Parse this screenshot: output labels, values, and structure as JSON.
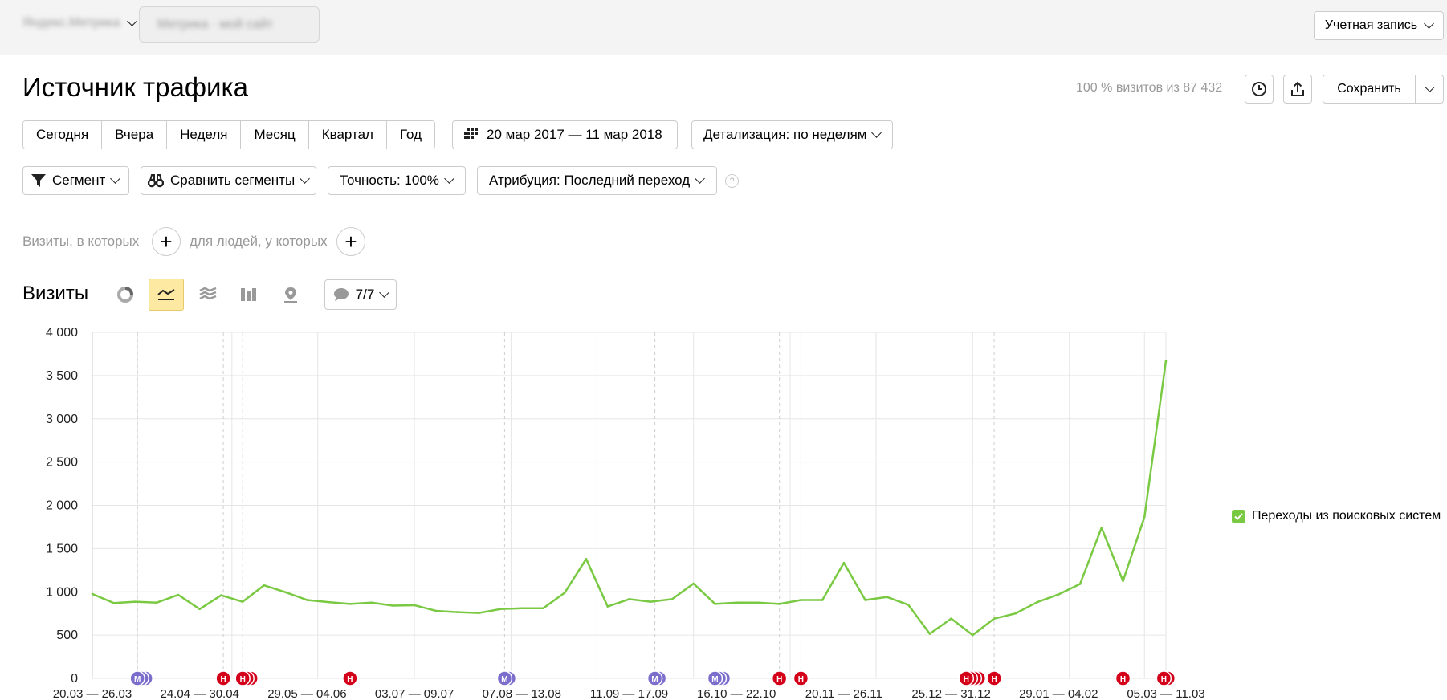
{
  "topbar": {
    "counter_name": "Яндекс.Метрика",
    "blurred_field": "Метрика · мой сайт",
    "account_label": "Учетная запись"
  },
  "header": {
    "title": "Источник трафика",
    "visits_info": "100 % визитов из 87 432",
    "save_label": "Сохранить",
    "icons": [
      "clock-icon",
      "export-icon",
      "chevron-down-icon"
    ]
  },
  "periods": [
    "Сегодня",
    "Вчера",
    "Неделя",
    "Месяц",
    "Квартал",
    "Год"
  ],
  "date_range": "20 мар 2017 — 11 мар 2018",
  "detail": "Детализация: по неделям",
  "filters": {
    "segment": "Сегмент",
    "compare": "Сравнить сегменты",
    "accuracy": "Точность: 100%",
    "attribution": "Атрибуция: Последний переход"
  },
  "conditions": {
    "visits_text": "Визиты, в которых",
    "people_text": "для людей, у которых"
  },
  "section": {
    "title": "Визиты",
    "notes_count": "7/7"
  },
  "colors": {
    "line": "#7ac943",
    "marker_m": "#7b6dcc",
    "marker_n": "#d4001a",
    "active_view": "#fde9a2"
  },
  "chart_data": {
    "type": "line",
    "y_ticks": [
      "4 000",
      "3 500",
      "3 000",
      "2 500",
      "2 000",
      "1 500",
      "1 000",
      "500",
      "0"
    ],
    "ylim": [
      0,
      4000
    ],
    "x_tick_labels": [
      "20.03 — 26.03",
      "24.04 — 30.04",
      "29.05 — 04.06",
      "03.07 — 09.07",
      "07.08 — 13.08",
      "11.09 — 17.09",
      "16.10 — 22.10",
      "20.11 — 26.11",
      "25.12 — 31.12",
      "29.01 — 04.02",
      "05.03 — 11.03"
    ],
    "x_tick_weeks": [
      0,
      5,
      10,
      15,
      20,
      25,
      30,
      35,
      40,
      45,
      50
    ],
    "grid": true,
    "legend_position": "right",
    "series": [
      {
        "name": "Переходы из поисковых систем",
        "values": [
          975,
          870,
          885,
          875,
          965,
          800,
          960,
          885,
          1075,
          995,
          905,
          880,
          860,
          875,
          840,
          845,
          780,
          765,
          755,
          800,
          810,
          810,
          990,
          1380,
          830,
          915,
          885,
          915,
          1095,
          860,
          875,
          875,
          860,
          905,
          905,
          1335,
          905,
          940,
          850,
          515,
          690,
          500,
          690,
          750,
          880,
          970,
          1090,
          1740,
          1125,
          1865,
          3670
        ]
      }
    ],
    "markers": [
      {
        "type": "М",
        "week": 2.1,
        "count": 3
      },
      {
        "type": "Н",
        "week": 6.1,
        "count": 1
      },
      {
        "type": "Н",
        "week": 7.0,
        "count": 3
      },
      {
        "type": "Н",
        "week": 12.0,
        "count": 1
      },
      {
        "type": "М",
        "week": 19.2,
        "count": 2
      },
      {
        "type": "М",
        "week": 26.2,
        "count": 2
      },
      {
        "type": "М",
        "week": 29.0,
        "count": 3
      },
      {
        "type": "Н",
        "week": 32.0,
        "count": 1
      },
      {
        "type": "Н",
        "week": 33.0,
        "count": 1
      },
      {
        "type": "Н",
        "week": 40.7,
        "count": 4
      },
      {
        "type": "Н",
        "week": 42.0,
        "count": 1
      },
      {
        "type": "Н",
        "week": 48.0,
        "count": 1
      },
      {
        "type": "Н",
        "week": 49.9,
        "count": 2
      }
    ],
    "dashed_weeks": [
      2.1,
      6.1,
      7.0,
      19.2,
      26.2,
      32.0,
      33.0,
      42.0,
      48.0
    ]
  }
}
